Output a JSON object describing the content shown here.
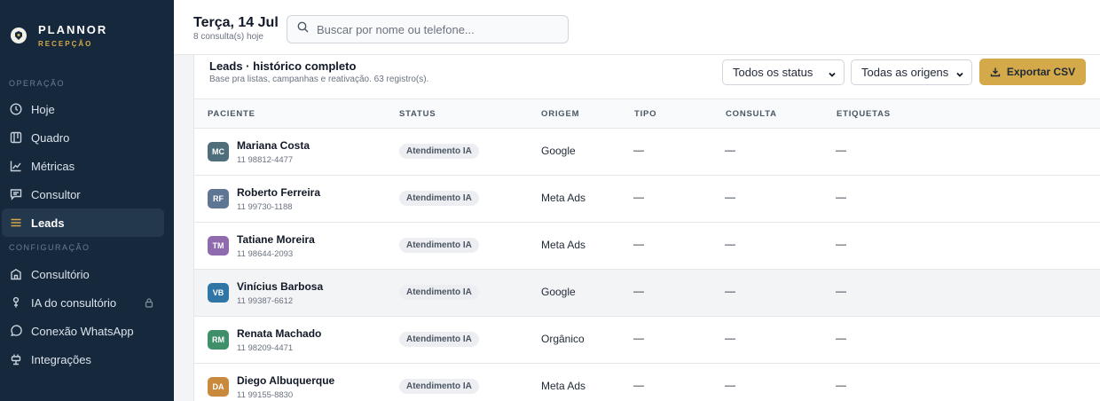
{
  "brand": {
    "name": "PLANNOR",
    "subtitle": "RECEPÇÃO"
  },
  "sidebar": {
    "sections": [
      {
        "label": "OPERAÇÃO"
      },
      {
        "label": "CONFIGURAÇÃO"
      }
    ],
    "operacao": [
      {
        "label": "Hoje",
        "icon": "clock-icon"
      },
      {
        "label": "Quadro",
        "icon": "kanban-icon"
      },
      {
        "label": "Métricas",
        "icon": "chart-icon"
      },
      {
        "label": "Consultor",
        "icon": "message-icon"
      },
      {
        "label": "Leads",
        "icon": "list-icon",
        "active": true
      }
    ],
    "configuracao": [
      {
        "label": "Consultório",
        "icon": "building-icon"
      },
      {
        "label": "IA do consultório",
        "icon": "ai-icon",
        "locked": true
      },
      {
        "label": "Conexão WhatsApp",
        "icon": "chat-bubble-icon"
      },
      {
        "label": "Integrações",
        "icon": "plug-icon"
      }
    ]
  },
  "header": {
    "date": "Terça, 14 Jul",
    "subtitle": "8 consulta(s) hoje",
    "search_placeholder": "Buscar por nome ou telefone..."
  },
  "leads": {
    "title": "Leads · histórico completo",
    "subtitle": "Base pra listas, campanhas e reativação. 63 registro(s).",
    "status_filter": "Todos os status",
    "origem_filter": "Todas as origens",
    "export_label": "Exportar CSV",
    "columns": [
      "PACIENTE",
      "STATUS",
      "ORIGEM",
      "TIPO",
      "CONSULTA",
      "ETIQUETAS"
    ],
    "rows": [
      {
        "initials": "MC",
        "color": "#4f6d7a",
        "name": "Mariana Costa",
        "phone": "11 98812-4477",
        "status": "Atendimento IA",
        "origem": "Google",
        "tipo": "—",
        "consulta": "—",
        "etiquetas": "—"
      },
      {
        "initials": "RF",
        "color": "#5f7594",
        "name": "Roberto Ferreira",
        "phone": "11 99730-1188",
        "status": "Atendimento IA",
        "origem": "Meta Ads",
        "tipo": "—",
        "consulta": "—",
        "etiquetas": "—"
      },
      {
        "initials": "TM",
        "color": "#8f6aae",
        "name": "Tatiane Moreira",
        "phone": "11 98644-2093",
        "status": "Atendimento IA",
        "origem": "Meta Ads",
        "tipo": "—",
        "consulta": "—",
        "etiquetas": "—"
      },
      {
        "initials": "VB",
        "color": "#2f76a6",
        "name": "Vinícius Barbosa",
        "phone": "11 99387-6612",
        "status": "Atendimento IA",
        "origem": "Google",
        "tipo": "—",
        "consulta": "—",
        "etiquetas": "—"
      },
      {
        "initials": "RM",
        "color": "#3f8f6b",
        "name": "Renata Machado",
        "phone": "11 98209-4471",
        "status": "Atendimento IA",
        "origem": "Orgânico",
        "tipo": "—",
        "consulta": "—",
        "etiquetas": "—"
      },
      {
        "initials": "DA",
        "color": "#c98a3e",
        "name": "Diego Albuquerque",
        "phone": "11 99155-8830",
        "status": "Atendimento IA",
        "origem": "Meta Ads",
        "tipo": "—",
        "consulta": "—",
        "etiquetas": "—"
      }
    ]
  }
}
